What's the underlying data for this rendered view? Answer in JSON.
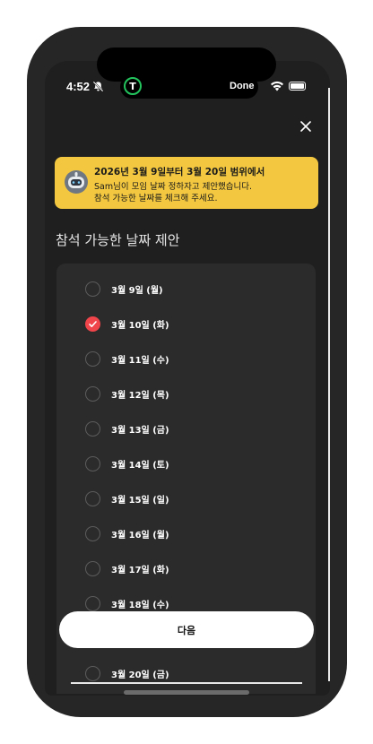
{
  "status_bar": {
    "time": "4:52",
    "bell_icon": "bell-slash-icon",
    "live_activity_badge": "T",
    "live_activity_action": "Done",
    "wifi_icon": "wifi-icon",
    "battery_icon": "battery-icon"
  },
  "header": {
    "close_icon": "close-icon"
  },
  "banner": {
    "title": "2026년 3월 9일부터 3월 20일 범위에서",
    "line1": "Sam님이 모임 날짜 정하자고 제안했습니다.",
    "line2": "참석 가능한 날짜를 체크해 주세요.",
    "background": "#f3c840",
    "avatar_icon": "robot-avatar-icon"
  },
  "section_title": "참석 가능한 날짜 제안",
  "dates": [
    {
      "label": "3월 9일 (월)",
      "checked": false
    },
    {
      "label": "3월 10일 (화)",
      "checked": true
    },
    {
      "label": "3월 11일 (수)",
      "checked": false
    },
    {
      "label": "3월 12일 (목)",
      "checked": false
    },
    {
      "label": "3월 13일 (금)",
      "checked": false
    },
    {
      "label": "3월 14일 (토)",
      "checked": false
    },
    {
      "label": "3월 15일 (일)",
      "checked": false
    },
    {
      "label": "3월 16일 (월)",
      "checked": false
    },
    {
      "label": "3월 17일 (화)",
      "checked": false
    },
    {
      "label": "3월 18일 (수)",
      "checked": false
    },
    {
      "label": "3월 20일 (금)",
      "checked": false
    }
  ],
  "next_button": "다음",
  "colors": {
    "accent_checked": "#f0454a",
    "background": "#1f1f1f",
    "card": "#2b2b2b"
  }
}
